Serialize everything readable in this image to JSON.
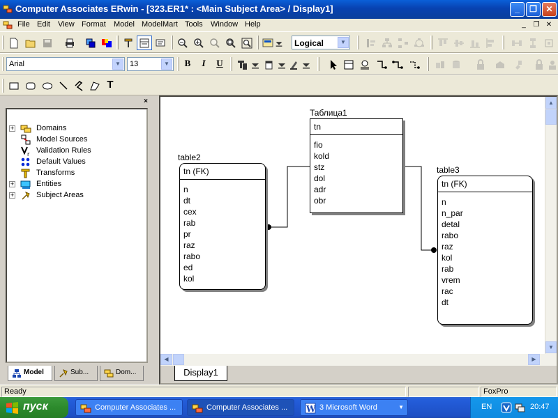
{
  "window": {
    "title": "Computer Associates ERwin - [323.ER1* : <Main Subject Area> / Display1]",
    "buttons": {
      "minimize": "_",
      "maximize": "❐",
      "close": "✕"
    }
  },
  "menubar": {
    "items": [
      "File",
      "Edit",
      "View",
      "Format",
      "Model",
      "ModelMart",
      "Tools",
      "Window",
      "Help"
    ],
    "mdi": {
      "minimize": "_",
      "restore": "❐",
      "close": "✕"
    }
  },
  "toolbar": {
    "view_level": "Logical",
    "font_name": "Arial",
    "font_size": "13",
    "format_buttons": {
      "bold": "B",
      "italic": "I",
      "underline": "U"
    },
    "text_tool": "T"
  },
  "model_tree": {
    "items": [
      {
        "label": "Domains",
        "icon": "domains-icon",
        "expandable": true
      },
      {
        "label": "Model Sources",
        "icon": "model-sources-icon",
        "expandable": false
      },
      {
        "label": "Validation Rules",
        "icon": "validation-rules-icon",
        "expandable": false
      },
      {
        "label": "Default Values",
        "icon": "default-values-icon",
        "expandable": false
      },
      {
        "label": "Transforms",
        "icon": "transforms-icon",
        "expandable": false
      },
      {
        "label": "Entities",
        "icon": "entities-icon",
        "expandable": true
      },
      {
        "label": "Subject Areas",
        "icon": "subject-areas-icon",
        "expandable": true
      }
    ],
    "tabs": [
      "Model",
      "Sub...",
      "Dom..."
    ]
  },
  "diagram": {
    "entities": [
      {
        "name": "Таблица1",
        "keys": [
          "tn"
        ],
        "attributes": [
          "fio",
          "kold",
          "stz",
          "dol",
          "adr",
          "obr"
        ]
      },
      {
        "name": "table2",
        "keys": [
          "tn (FK)"
        ],
        "attributes": [
          "n",
          "dt",
          "cex",
          "rab",
          "pr",
          "raz",
          "rabo",
          "ed",
          "kol"
        ]
      },
      {
        "name": "table3",
        "keys": [
          "tn (FK)"
        ],
        "attributes": [
          "n",
          "n_par",
          "detal",
          "rabo",
          "raz",
          "kol",
          "rab",
          "vrem",
          "rac",
          "dt"
        ]
      }
    ],
    "tab": "Display1"
  },
  "statusbar": {
    "status": "Ready",
    "target_db": "FoxPro"
  },
  "taskbar": {
    "start_label": "пуск",
    "tasks": [
      "Computer Associates ...",
      "Computer Associates ...",
      "3 Microsoft Word"
    ],
    "language": "EN",
    "clock": "20:47"
  }
}
